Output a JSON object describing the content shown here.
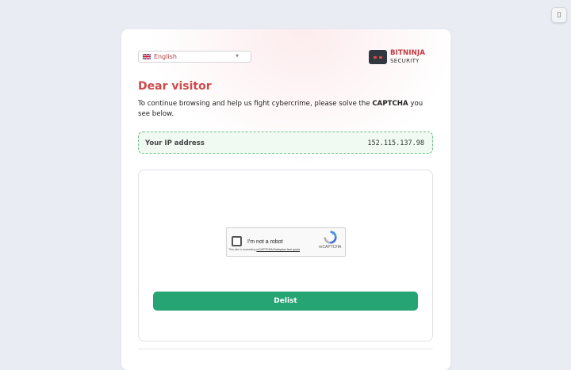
{
  "floating_button": {
    "icon": "page-icon",
    "glyph": "▯"
  },
  "language_select": {
    "selected": "English",
    "flag_icon": "uk-flag-icon"
  },
  "logo": {
    "brand": "BITNINJA",
    "sub": "SECURITY",
    "brand_color": "#c8353b"
  },
  "page": {
    "title": "Dear visitor",
    "intro_before": "To continue browsing and help us fight cybercrime, please solve the ",
    "intro_bold": "CAPTCHA",
    "intro_after": " you see below."
  },
  "ip": {
    "label": "Your IP address",
    "value": "152.115.137.98"
  },
  "captcha": {
    "checkbox_label": "I'm not a robot",
    "brand": "reCAPTCHA",
    "note_prefix": "This site is exceeding ",
    "note_link": "reCAPTCHA Enterprise free quota"
  },
  "actions": {
    "delist_label": "Delist"
  },
  "colors": {
    "accent_red": "#cf4a4a",
    "accent_green": "#26a474",
    "ip_border": "#6fc08a",
    "background": "#e9edf3"
  }
}
